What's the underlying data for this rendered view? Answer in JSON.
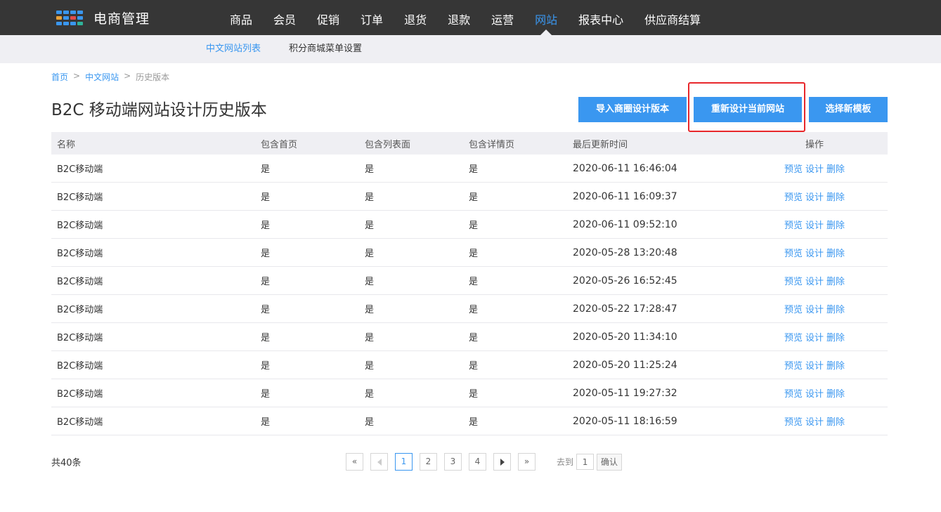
{
  "colors": {
    "brand": "#3a97f0",
    "topbar": "#363636",
    "subbar": "#efeff3",
    "highlight": "#e8272b"
  },
  "logo": {
    "text": "电商管理",
    "grid_colors": [
      "#3a97f0",
      "#3a97f0",
      "#3a97f0",
      "#3a97f0",
      "#e8a23a",
      "#3a97f0",
      "#e04b4b",
      "#3a97f0",
      "#3a97f0",
      "#3a97f0",
      "#3a97f0",
      "#2fb39a"
    ]
  },
  "nav": {
    "items": [
      {
        "label": "商品"
      },
      {
        "label": "会员"
      },
      {
        "label": "促销"
      },
      {
        "label": "订单"
      },
      {
        "label": "退货"
      },
      {
        "label": "退款"
      },
      {
        "label": "运营"
      },
      {
        "label": "网站",
        "active": true
      },
      {
        "label": "报表中心"
      },
      {
        "label": "供应商结算"
      }
    ]
  },
  "subnav": {
    "items": [
      {
        "label": "中文网站列表",
        "active": true
      },
      {
        "label": "积分商城菜单设置"
      }
    ]
  },
  "breadcrumb": {
    "home": "首页",
    "level2": "中文网站",
    "current": "历史版本",
    "sep": ">"
  },
  "page": {
    "title": "B2C 移动端网站设计历史版本"
  },
  "buttons": {
    "import": "导入商圈设计版本",
    "redesign": "重新设计当前网站",
    "new_template": "选择新模板"
  },
  "table": {
    "headers": [
      "名称",
      "包含首页",
      "包含列表面",
      "包含详情页",
      "最后更新时间",
      "操作"
    ],
    "ops": {
      "preview": "预览",
      "design": "设计",
      "delete": "删除"
    },
    "rows": [
      {
        "name": "B2C移动端",
        "home": "是",
        "list": "是",
        "detail": "是",
        "updated": "2020-06-11 16:46:04"
      },
      {
        "name": "B2C移动端",
        "home": "是",
        "list": "是",
        "detail": "是",
        "updated": "2020-06-11 16:09:37"
      },
      {
        "name": "B2C移动端",
        "home": "是",
        "list": "是",
        "detail": "是",
        "updated": "2020-06-11 09:52:10"
      },
      {
        "name": "B2C移动端",
        "home": "是",
        "list": "是",
        "detail": "是",
        "updated": "2020-05-28 13:20:48"
      },
      {
        "name": "B2C移动端",
        "home": "是",
        "list": "是",
        "detail": "是",
        "updated": "2020-05-26 16:52:45"
      },
      {
        "name": "B2C移动端",
        "home": "是",
        "list": "是",
        "detail": "是",
        "updated": "2020-05-22 17:28:47"
      },
      {
        "name": "B2C移动端",
        "home": "是",
        "list": "是",
        "detail": "是",
        "updated": "2020-05-20 11:34:10"
      },
      {
        "name": "B2C移动端",
        "home": "是",
        "list": "是",
        "detail": "是",
        "updated": "2020-05-20 11:25:24"
      },
      {
        "name": "B2C移动端",
        "home": "是",
        "list": "是",
        "detail": "是",
        "updated": "2020-05-11 19:27:32"
      },
      {
        "name": "B2C移动端",
        "home": "是",
        "list": "是",
        "detail": "是",
        "updated": "2020-05-11 18:16:59"
      }
    ]
  },
  "footer": {
    "total": "共40条",
    "pager": {
      "first": "«",
      "last": "»",
      "pages": [
        "1",
        "2",
        "3",
        "4"
      ],
      "current": "1"
    },
    "goto_label": "去到",
    "goto_value": "1",
    "confirm": "确认"
  }
}
